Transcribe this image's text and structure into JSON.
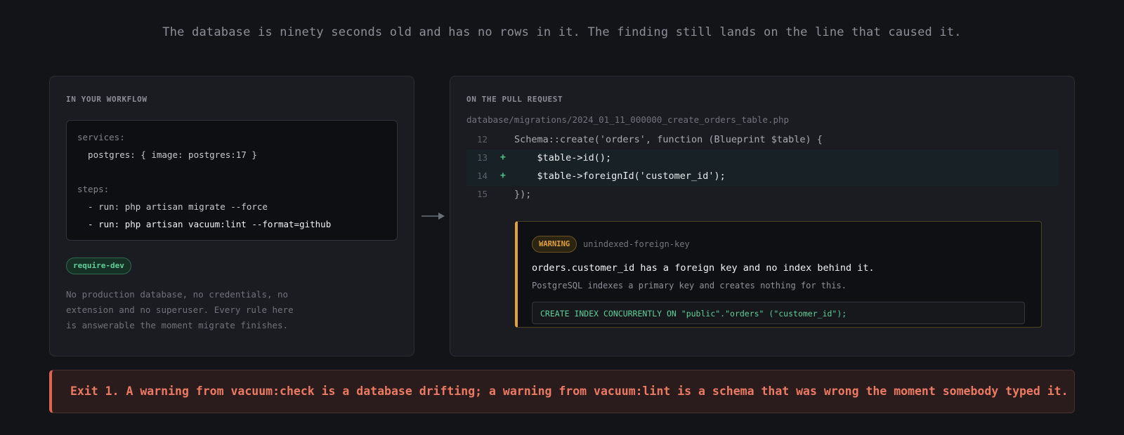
{
  "headline": "The database is ninety seconds old and has no rows in it. The finding still lands on the line that caused it.",
  "left_panel": {
    "label": "IN YOUR WORKFLOW",
    "code_lines": [
      "services:",
      "  postgres: { image: postgres:17 }",
      "steps:",
      "  - run: php artisan migrate --force",
      "  - run: php artisan vacuum:lint --format=github"
    ],
    "badge": "require-dev",
    "note_lines": [
      "No production database, no credentials, no",
      "extension and no superuser. Every rule here",
      "is answerable the moment migrate finishes."
    ]
  },
  "right_panel": {
    "label": "ON THE PULL REQUEST",
    "file_path": "database/migrations/2024_01_11_000000_create_orders_table.php",
    "diff": [
      {
        "line": "12",
        "marker": "",
        "code": "Schema::create('orders', function (Blueprint $table) {"
      },
      {
        "line": "13",
        "marker": "+",
        "code": "    $table->id();"
      },
      {
        "line": "14",
        "marker": "+",
        "code": "    $table->foreignId('customer_id');"
      },
      {
        "line": "15",
        "marker": "",
        "code": "});"
      }
    ],
    "finding": {
      "severity": "WARNING",
      "rule": "unindexed-foreign-key",
      "title": "orders.customer_id has a foreign key and no index behind it.",
      "description": "PostgreSQL indexes a primary key and creates nothing for this.",
      "fix_sql": "CREATE INDEX CONCURRENTLY ON \"public\".\"orders\" (\"customer_id\");"
    }
  },
  "banner": "Exit 1. A warning from vacuum:check is a database drifting; a warning from vacuum:lint is a schema that was wrong the moment somebody typed it.",
  "colors": {
    "background": "#131418",
    "warning": "#e2a23b",
    "added": "#4fc28a",
    "error": "#ec7a63"
  }
}
